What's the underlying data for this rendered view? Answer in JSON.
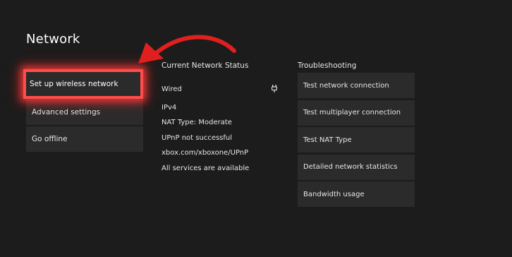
{
  "page": {
    "title": "Network"
  },
  "menu": {
    "items": [
      {
        "label": "Set up wireless network"
      },
      {
        "label": "Advanced settings"
      },
      {
        "label": "Go offline"
      }
    ]
  },
  "status": {
    "heading": "Current Network Status",
    "connection": "Wired",
    "connection_icon": "wired-plug-icon",
    "ip_version": "IPv4",
    "nat_type": "NAT Type: Moderate",
    "upnp": "UPnP not successful",
    "upnp_link": "xbox.com/xboxone/UPnP",
    "services": "All services are available"
  },
  "troubleshooting": {
    "heading": "Troubleshooting",
    "items": [
      {
        "label": "Test network connection"
      },
      {
        "label": "Test multiplayer connection"
      },
      {
        "label": "Test NAT Type"
      },
      {
        "label": "Detailed network statistics"
      },
      {
        "label": "Bandwidth usage"
      }
    ]
  },
  "colors": {
    "background": "#1c1c1c",
    "tile": "#2b2b2b",
    "highlight": "#ff4d4d",
    "arrow": "#e0201e"
  }
}
